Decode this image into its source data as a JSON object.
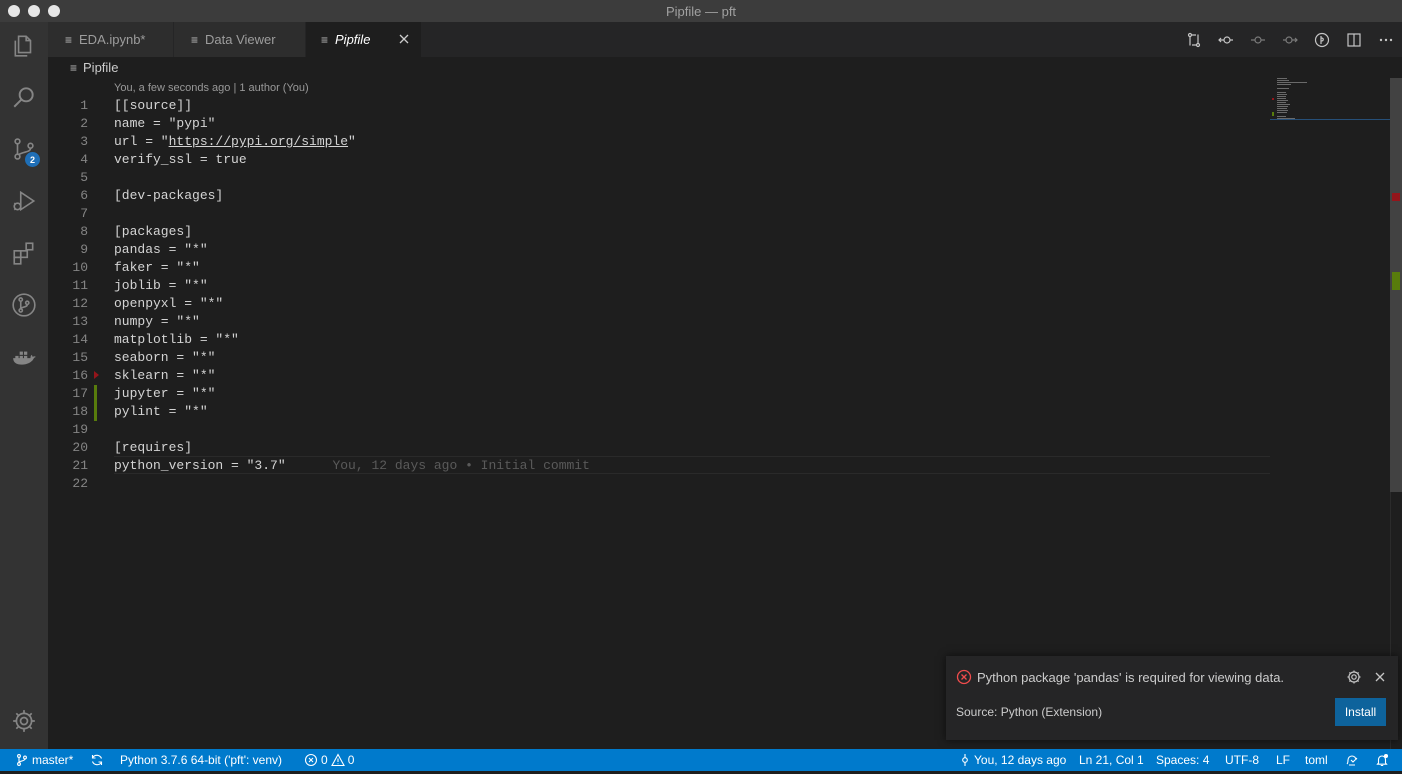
{
  "window": {
    "title": "Pipfile — pft"
  },
  "activity_bar": {
    "scm_badge": "2"
  },
  "tabs": [
    {
      "label": "EDA.ipynb*",
      "active": false
    },
    {
      "label": "Data Viewer",
      "active": false
    },
    {
      "label": "Pipfile",
      "active": true
    }
  ],
  "breadcrumb": {
    "file": "Pipfile"
  },
  "codelens": "You, a few seconds ago | 1 author (You)",
  "editor": {
    "lines": [
      {
        "num": "1",
        "text": "[[source]]"
      },
      {
        "num": "2",
        "text": "name = \"pypi\""
      },
      {
        "num": "3",
        "prefix": "url = \"",
        "link": "https://pypi.org/simple",
        "suffix": "\""
      },
      {
        "num": "4",
        "text": "verify_ssl = true"
      },
      {
        "num": "5",
        "text": ""
      },
      {
        "num": "6",
        "text": "[dev-packages]"
      },
      {
        "num": "7",
        "text": ""
      },
      {
        "num": "8",
        "text": "[packages]"
      },
      {
        "num": "9",
        "text": "pandas = \"*\""
      },
      {
        "num": "10",
        "text": "faker = \"*\""
      },
      {
        "num": "11",
        "text": "joblib = \"*\""
      },
      {
        "num": "12",
        "text": "openpyxl = \"*\""
      },
      {
        "num": "13",
        "text": "numpy = \"*\""
      },
      {
        "num": "14",
        "text": "matplotlib = \"*\""
      },
      {
        "num": "15",
        "text": "seaborn = \"*\""
      },
      {
        "num": "16",
        "text": "sklearn = \"*\""
      },
      {
        "num": "17",
        "text": "jupyter = \"*\""
      },
      {
        "num": "18",
        "text": "pylint = \"*\""
      },
      {
        "num": "19",
        "text": ""
      },
      {
        "num": "20",
        "text": "[requires]"
      },
      {
        "num": "21",
        "text": "python_version = \"3.7\""
      },
      {
        "num": "22",
        "text": ""
      }
    ],
    "blame": "You, 12 days ago • Initial commit"
  },
  "notification": {
    "message": "Python package 'pandas' is required for viewing data.",
    "source": "Source: Python (Extension)",
    "button": "Install"
  },
  "statusbar": {
    "branch": "master*",
    "interpreter": "Python 3.7.6 64-bit ('pft': venv)",
    "errors": "0",
    "warnings": "0",
    "blame": "You, 12 days ago",
    "position": "Ln 21, Col 1",
    "spaces": "Spaces: 4",
    "encoding": "UTF-8",
    "eol": "LF",
    "language": "toml"
  },
  "colors": {
    "statusbar": "#007acc",
    "activity_bar": "#333333",
    "editor_bg": "#1e1e1e",
    "install_button": "#0e639c",
    "error": "#f14c4c",
    "gutter_added": "#587c0c"
  }
}
